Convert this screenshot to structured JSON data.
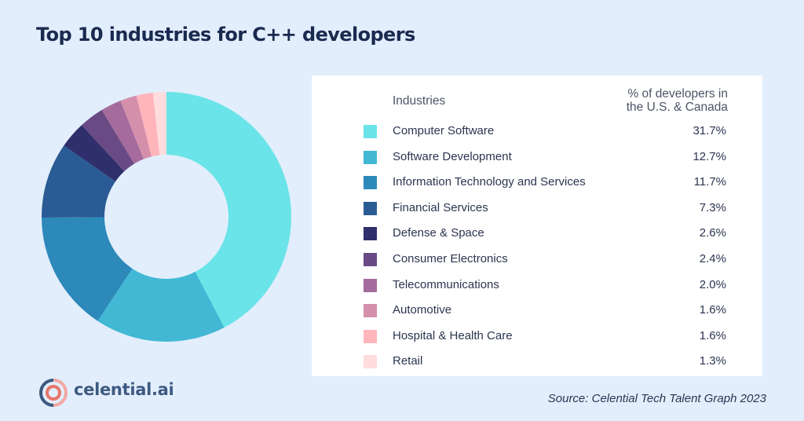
{
  "header": {
    "title": "Top 10 industries for C++ developers"
  },
  "table": {
    "col_industries": "Industries",
    "col_percent_line1": "% of developers in",
    "col_percent_line2": "the U.S. & Canada"
  },
  "chart_data": {
    "type": "pie",
    "variant": "donut",
    "title": "Top 10 industries for C++ developers",
    "value_label": "% of developers in the U.S. & Canada",
    "start_angle": "12 o'clock, clockwise",
    "legend_placement": "right",
    "categories": [
      "Computer Software",
      "Software Development",
      "Information Technology and Services",
      "Financial Services",
      "Defense & Space",
      "Consumer Electronics",
      "Telecommunications",
      "Automotive",
      "Hospital & Health Care",
      "Retail"
    ],
    "values": [
      31.7,
      12.7,
      11.7,
      7.3,
      2.6,
      2.4,
      2.0,
      1.6,
      1.6,
      1.3
    ],
    "value_labels": [
      "31.7%",
      "12.7%",
      "11.7%",
      "7.3%",
      "2.6%",
      "2.4%",
      "2.0%",
      "1.6%",
      "1.6%",
      "1.3%"
    ],
    "colors": [
      "#6ae4e8",
      "#42b8d4",
      "#2c89ba",
      "#2b5b94",
      "#2e2f6b",
      "#6a4a85",
      "#a46b9c",
      "#d48fab",
      "#ffb5ba",
      "#ffdcdd"
    ]
  },
  "footer": {
    "brand": "celential.ai",
    "source": "Source: Celential Tech Talent Graph 2023",
    "logo_colors": {
      "outer": "#3d5a80",
      "inner": "#e8766a",
      "accent": "#f2a9a3"
    }
  }
}
